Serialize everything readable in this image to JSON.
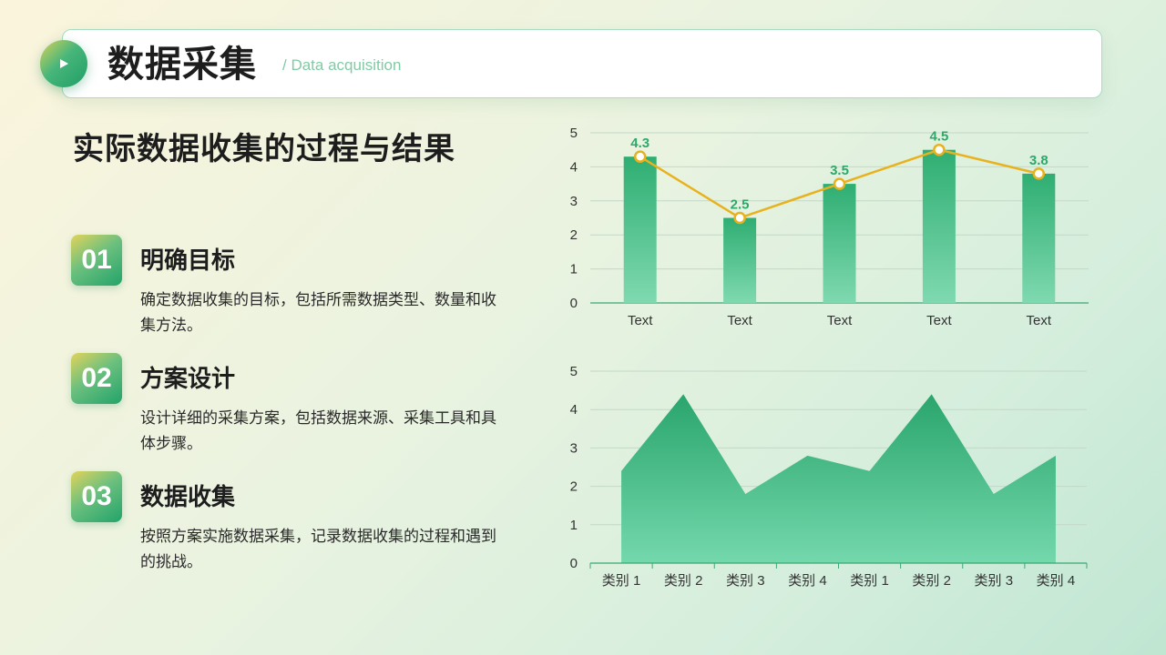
{
  "header": {
    "title": "数据采集",
    "subtitle": "/ Data acquisition"
  },
  "section_title": "实际数据收集的过程与结果",
  "items": [
    {
      "number": "01",
      "title": "明确目标",
      "desc": "确定数据收集的目标，包括所需数据类型、数量和收集方法。"
    },
    {
      "number": "02",
      "title": "方案设计",
      "desc": "设计详细的采集方案，包括数据来源、采集工具和具体步骤。"
    },
    {
      "number": "03",
      "title": "数据收集",
      "desc": "按照方案实施数据采集，记录数据收集的过程和遇到的挑战。"
    }
  ],
  "colors": {
    "accent_green": "#2fae72",
    "light_green": "#7fd9b0",
    "line_yellow": "#e8b21e",
    "label_green": "#2ea86a"
  },
  "icons": {
    "play": "play-icon"
  },
  "chart_data": [
    {
      "type": "bar",
      "categories": [
        "Text",
        "Text",
        "Text",
        "Text",
        "Text"
      ],
      "series": [
        {
          "values": [
            4.3,
            2.5,
            3.5,
            4.5,
            3.8
          ]
        }
      ],
      "line_overlay": true,
      "data_labels": [
        "4.3",
        "2.5",
        "3.5",
        "4.5",
        "3.8"
      ],
      "ylim": [
        0,
        5
      ],
      "yticks": [
        "0",
        "1",
        "2",
        "3",
        "4",
        "5"
      ],
      "grid": true
    },
    {
      "type": "area",
      "categories": [
        "类别 1",
        "类别 2",
        "类别 3",
        "类别 4",
        "类别 1",
        "类别 2",
        "类别 3",
        "类别 4"
      ],
      "series": [
        {
          "values": [
            2.4,
            4.4,
            1.8,
            2.8,
            2.4,
            4.4,
            1.8,
            2.8
          ]
        }
      ],
      "ylim": [
        0,
        5
      ],
      "yticks": [
        "0",
        "1",
        "2",
        "3",
        "4",
        "5"
      ],
      "grid": true
    }
  ]
}
